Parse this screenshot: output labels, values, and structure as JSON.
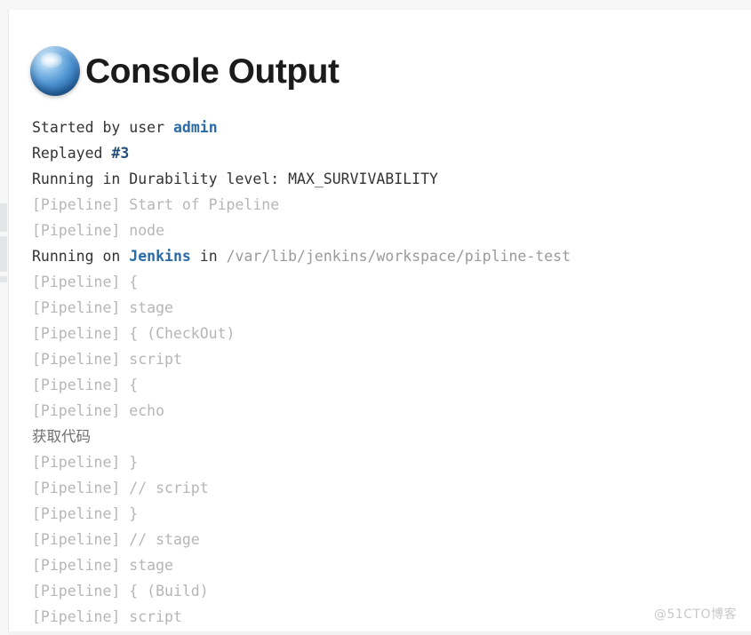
{
  "header": {
    "title": "Console Output",
    "icon": "jenkins-blue-ball-icon"
  },
  "console": {
    "lines": [
      {
        "segments": [
          {
            "text": "Started by user ",
            "style": "plain"
          },
          {
            "text": "admin",
            "style": "link"
          }
        ]
      },
      {
        "segments": [
          {
            "text": "Replayed ",
            "style": "plain"
          },
          {
            "text": "#3",
            "style": "build"
          }
        ]
      },
      {
        "segments": [
          {
            "text": "Running in Durability level: MAX_SURVIVABILITY",
            "style": "plain"
          }
        ]
      },
      {
        "segments": [
          {
            "text": "[Pipeline] Start of Pipeline",
            "style": "pipeline"
          }
        ]
      },
      {
        "segments": [
          {
            "text": "[Pipeline] node",
            "style": "pipeline"
          }
        ]
      },
      {
        "segments": [
          {
            "text": "Running on ",
            "style": "plain"
          },
          {
            "text": "Jenkins",
            "style": "link"
          },
          {
            "text": " in ",
            "style": "plain"
          },
          {
            "text": "/var/lib/jenkins/workspace/pipline-test",
            "style": "path"
          }
        ]
      },
      {
        "segments": [
          {
            "text": "[Pipeline] {",
            "style": "pipeline"
          }
        ]
      },
      {
        "segments": [
          {
            "text": "[Pipeline] stage",
            "style": "pipeline"
          }
        ]
      },
      {
        "segments": [
          {
            "text": "[Pipeline] { (CheckOut)",
            "style": "pipeline"
          }
        ]
      },
      {
        "segments": [
          {
            "text": "[Pipeline] script",
            "style": "pipeline"
          }
        ]
      },
      {
        "segments": [
          {
            "text": "[Pipeline] {",
            "style": "pipeline"
          }
        ]
      },
      {
        "segments": [
          {
            "text": "[Pipeline] echo",
            "style": "pipeline"
          }
        ]
      },
      {
        "segments": [
          {
            "text": "获取代码",
            "style": "echo"
          }
        ]
      },
      {
        "segments": [
          {
            "text": "[Pipeline] }",
            "style": "pipeline"
          }
        ]
      },
      {
        "segments": [
          {
            "text": "[Pipeline] // script",
            "style": "pipeline"
          }
        ]
      },
      {
        "segments": [
          {
            "text": "[Pipeline] }",
            "style": "pipeline"
          }
        ]
      },
      {
        "segments": [
          {
            "text": "[Pipeline] // stage",
            "style": "pipeline"
          }
        ]
      },
      {
        "segments": [
          {
            "text": "[Pipeline] stage",
            "style": "pipeline"
          }
        ]
      },
      {
        "segments": [
          {
            "text": "[Pipeline] { (Build)",
            "style": "pipeline"
          }
        ]
      },
      {
        "segments": [
          {
            "text": "[Pipeline] script",
            "style": "pipeline"
          }
        ]
      }
    ]
  },
  "watermark": {
    "text": "@51CTO博客"
  },
  "colors": {
    "link": "#2a6ba6",
    "pipeline": "#b6b6b6",
    "plain": "#333333",
    "echo": "#6f6f6f",
    "title": "#1b1b1b",
    "ball": "#4a8fce"
  }
}
